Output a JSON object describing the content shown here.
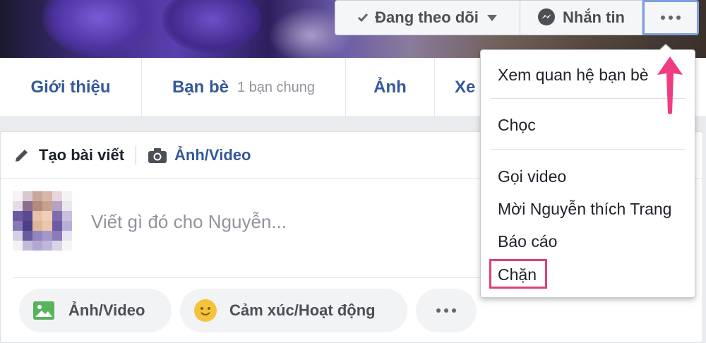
{
  "cover_actions": {
    "follow_label": "Đang theo dõi",
    "message_label": "Nhắn tin"
  },
  "tabs": [
    {
      "label": "Giới thiệu"
    },
    {
      "label": "Bạn bè",
      "sub": "1 bạn chung"
    },
    {
      "label": "Ảnh"
    },
    {
      "label": "Xe"
    }
  ],
  "composer": {
    "create_post_label": "Tạo bài viết",
    "photo_video_label": "Ảnh/Video",
    "placeholder": "Viết gì đó cho Nguyễn...",
    "actions": [
      {
        "label": "Ảnh/Video"
      },
      {
        "label": "Cảm xúc/Hoạt động"
      }
    ]
  },
  "dropdown": {
    "items": [
      {
        "label": "Xem quan hệ bạn bè"
      },
      {
        "label": "Chọc"
      },
      {
        "label": "Gọi video"
      },
      {
        "label": "Mời Nguyễn thích Trang"
      },
      {
        "label": "Báo cáo"
      },
      {
        "label": "Chặn"
      }
    ]
  },
  "colors": {
    "link_blue": "#365899",
    "highlight_pink": "#e0407a",
    "arrow_pink": "#f03c82"
  },
  "icons": [
    "check-icon",
    "caret-down-icon",
    "messenger-icon",
    "more-dots-icon",
    "pencil-icon",
    "camera-icon",
    "photo-icon",
    "smile-icon",
    "arrow-up-icon"
  ]
}
